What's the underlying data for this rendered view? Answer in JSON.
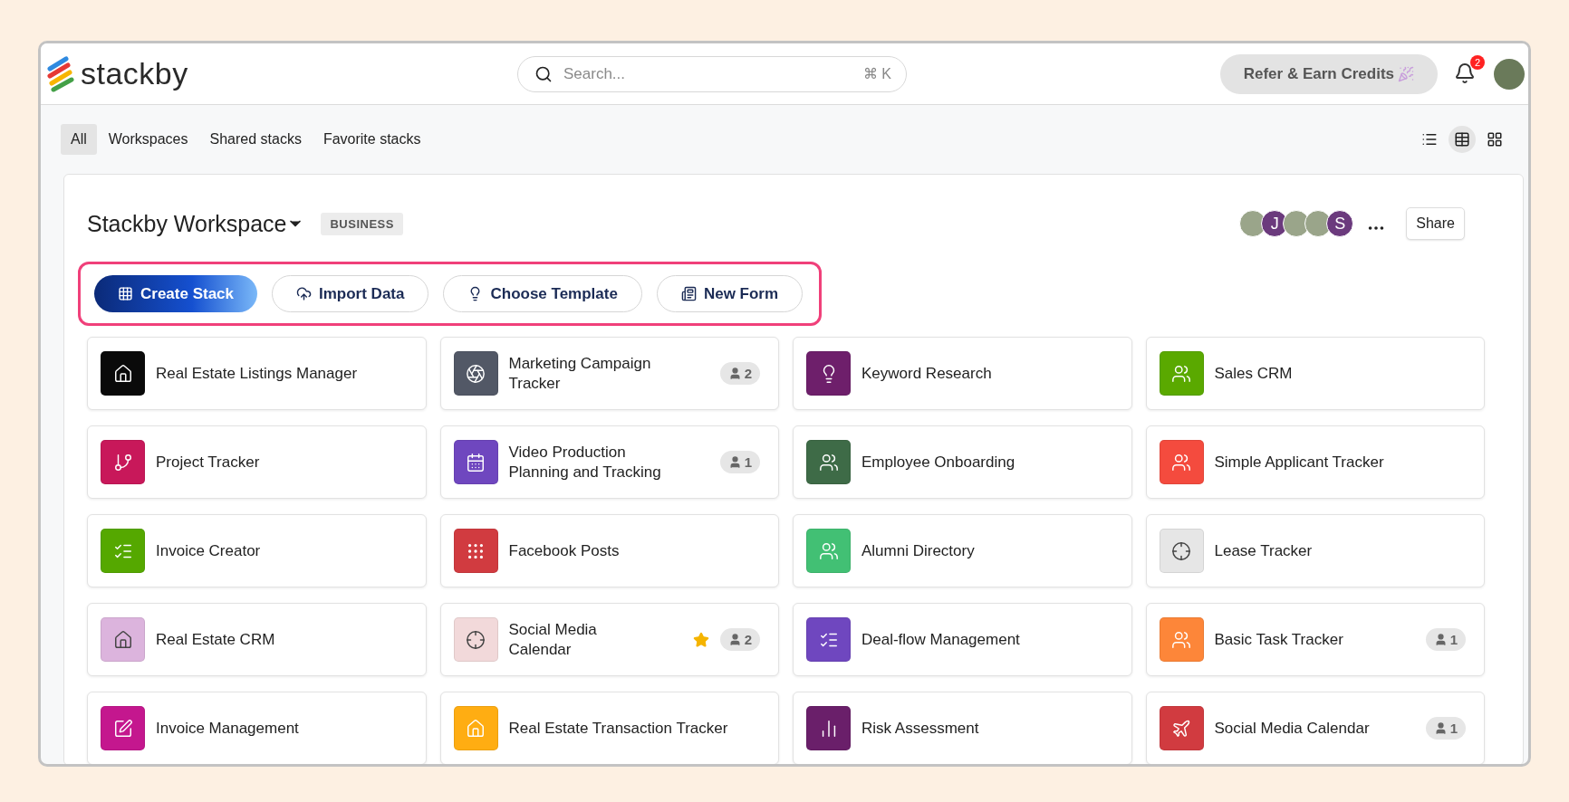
{
  "logo": {
    "text": "stackby"
  },
  "search": {
    "placeholder": "Search...",
    "shortcut": "⌘ K"
  },
  "refer_button": {
    "label": "Refer & Earn Credits"
  },
  "notifications": {
    "count": "2"
  },
  "filter_tabs": [
    {
      "label": "All",
      "selected": true
    },
    {
      "label": "Workspaces",
      "selected": false
    },
    {
      "label": "Shared stacks",
      "selected": false
    },
    {
      "label": "Favorite stacks",
      "selected": false
    }
  ],
  "view_toggles": [
    {
      "kind": "list",
      "selected": false
    },
    {
      "kind": "table",
      "selected": true
    },
    {
      "kind": "grid",
      "selected": false
    }
  ],
  "workspace": {
    "title": "Stackby Workspace",
    "plan": "BUSINESS",
    "members": [
      {
        "kind": "photo"
      },
      {
        "kind": "letter",
        "initial": "J",
        "color": "#6b3a7d"
      },
      {
        "kind": "photo"
      },
      {
        "kind": "photo"
      },
      {
        "kind": "letter",
        "initial": "S",
        "color": "#6b3a7d"
      }
    ],
    "share_label": "Share",
    "actions": [
      {
        "kind": "primary",
        "label": "Create Stack"
      },
      {
        "kind": "import",
        "label": "Import Data"
      },
      {
        "kind": "template",
        "label": "Choose Template"
      },
      {
        "kind": "form",
        "label": "New Form"
      }
    ]
  },
  "stacks": [
    {
      "name": "Real Estate Listings Manager",
      "color": "#0a0a0a"
    },
    {
      "name": "Marketing Campaign Tracker",
      "color": "#525866",
      "members": "2"
    },
    {
      "name": "Keyword Research",
      "color": "#6e1f6b"
    },
    {
      "name": "Sales CRM",
      "color": "#5aa900"
    },
    {
      "name": "Project Tracker",
      "color": "#c8185a"
    },
    {
      "name": "Video Production Planning and Tracking",
      "color": "#6f47bf",
      "members": "1"
    },
    {
      "name": "Employee Onboarding",
      "color": "#3e6b47"
    },
    {
      "name": "Simple Applicant Tracker",
      "color": "#f44b3e"
    },
    {
      "name": "Invoice Creator",
      "color": "#55a800"
    },
    {
      "name": "Facebook Posts",
      "color": "#d13b40"
    },
    {
      "name": "Alumni Directory",
      "color": "#42c074"
    },
    {
      "name": "Lease Tracker",
      "color": "#e6e6e6"
    },
    {
      "name": "Real Estate CRM",
      "color": "#dcb4dd"
    },
    {
      "name": "Social Media Calendar",
      "color": "#f2d9da",
      "favorite": true,
      "members": "2"
    },
    {
      "name": "Deal-flow Management",
      "color": "#6f47bf"
    },
    {
      "name": "Basic Task Tracker",
      "color": "#fd8639",
      "members": "1"
    },
    {
      "name": "Invoice Management",
      "color": "#c4178e"
    },
    {
      "name": "Real Estate Transaction Tracker",
      "color": "#ffad12"
    },
    {
      "name": "Risk Assessment",
      "color": "#6a1f6a"
    },
    {
      "name": "Social Media Calendar",
      "color": "#d13b40",
      "members": "1"
    }
  ]
}
